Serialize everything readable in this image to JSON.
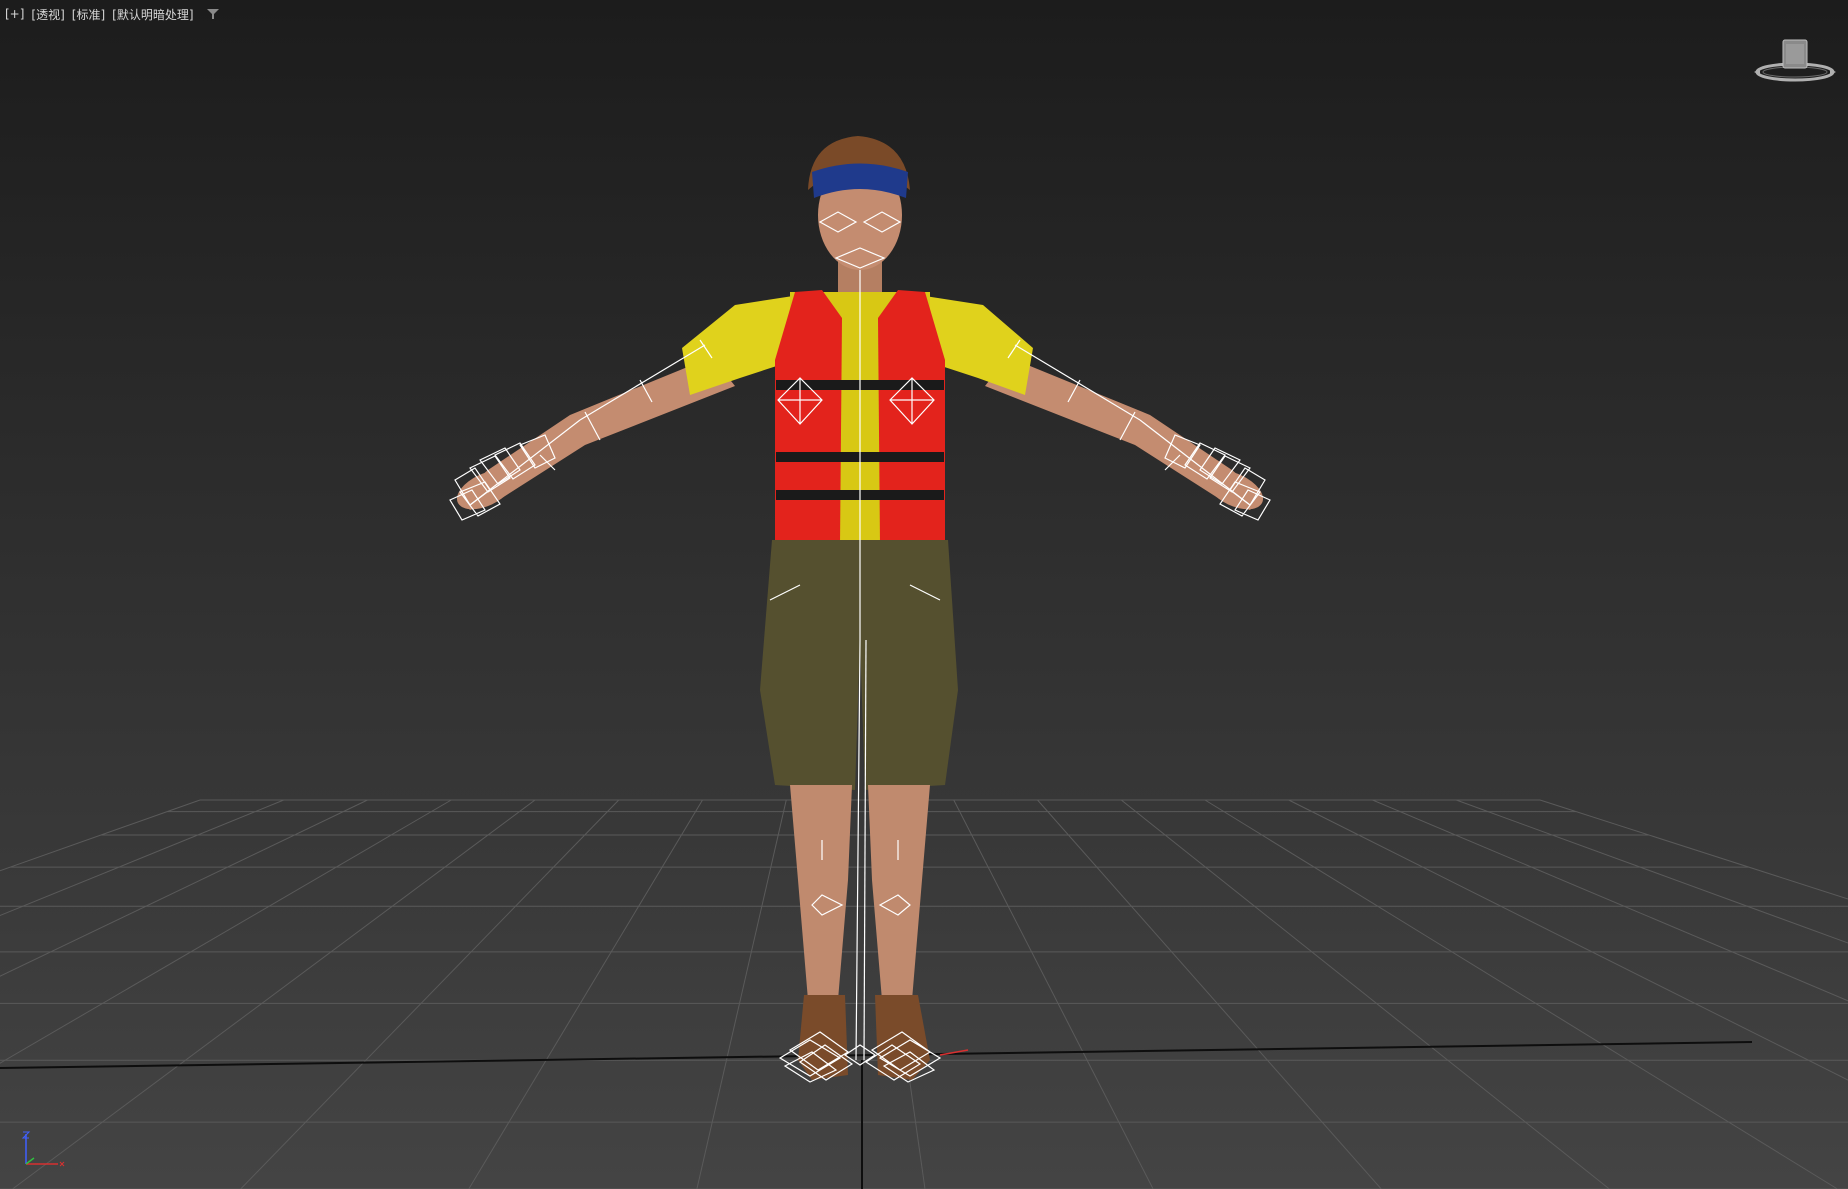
{
  "viewport": {
    "label_plus": "[+]",
    "label_view": "[透视]",
    "label_shading": "[标准]",
    "label_lighting": "[默认明暗处理]"
  },
  "icons": {
    "filter": "filter-funnel-icon",
    "viewcube": "viewcube-icon",
    "axis": "world-axis-tripod-icon"
  },
  "colors": {
    "background_top": "#1c1c1c",
    "background_bottom": "#444444",
    "grid": "#5a5a5a",
    "shirt": "#e0d21c",
    "vest": "#e3231c",
    "shorts": "#55502f",
    "headband": "#1f3a8c",
    "skin": "#c08a6e",
    "bone": "#ffffff",
    "axis_x": "#d83030",
    "axis_y": "#30c040",
    "axis_z": "#4060ff"
  }
}
